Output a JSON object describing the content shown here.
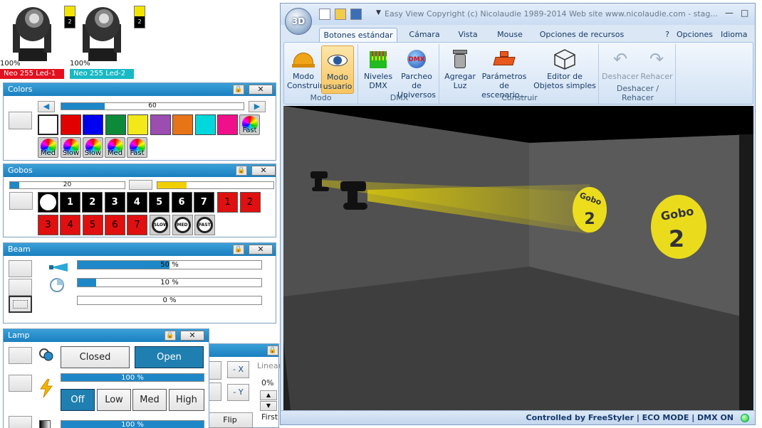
{
  "fixtures": [
    {
      "name": "Neo 255 Led-1",
      "percent": "100%",
      "badge": "2",
      "color": "#e3101f"
    },
    {
      "name": "Neo 255 Led-2",
      "percent": "100%",
      "badge": "2",
      "color": "#18b9c4"
    }
  ],
  "colors_panel": {
    "title": "Colors",
    "slider_value": "60",
    "slider_fraction": 0.24,
    "swatches": [
      "#ffffff",
      "#e30000",
      "#0000f0",
      "#0c8a3a",
      "#f2e81a",
      "#9b4db0",
      "#e87418",
      "#00d8dc",
      "#f0108a"
    ],
    "speed_labels": [
      "Fast",
      "Med",
      "Slow",
      "Slow",
      "Med",
      "Fast"
    ]
  },
  "gobos_panel": {
    "title": "Gobos",
    "slider_value": "20",
    "slider_fraction": 0.08,
    "yellow_fraction": 0.25,
    "gobos_black": [
      "1",
      "2",
      "3",
      "4",
      "5",
      "6",
      "7"
    ],
    "gobos_red": [
      "1",
      "2",
      "3",
      "4",
      "5",
      "6",
      "7"
    ],
    "rotation_labels": [
      "SLOW",
      "MED",
      "FAST"
    ]
  },
  "beam_panel": {
    "title": "Beam",
    "sliders": [
      {
        "label": "50 %",
        "fraction": 0.5
      },
      {
        "label": "10 %",
        "fraction": 0.1
      },
      {
        "label": "0 %",
        "fraction": 0.0
      }
    ]
  },
  "lamp_panel": {
    "title": "Lamp",
    "closed_label": "Closed",
    "open_label": "Open",
    "slider1_label": "100 %",
    "power_buttons": [
      "Off",
      "Low",
      "Med",
      "High"
    ],
    "slider2_label": "100 %"
  },
  "hidden_panel": {
    "linear_label": "Linear",
    "zero_pct": "0%",
    "first_label": "First",
    "minus_x": "- X",
    "minus_y": "- Y",
    "flip": "Flip"
  },
  "window": {
    "title": "Easy View   Copyright (c) Nicolaudie 1989-2014   Web site www.nicolaudie.com - stag...",
    "app_button": "3D",
    "tabs": [
      "Botones estándar",
      "Cámara",
      "Vista",
      "Mouse",
      "Opciones de recursos"
    ],
    "right_menu": [
      "?",
      "Opciones",
      "Idioma"
    ],
    "ribbon_groups": [
      {
        "name": "Modo",
        "buttons": [
          "Modo Construir",
          "Modo usuario"
        ]
      },
      {
        "name": "DMX",
        "buttons": [
          "Niveles DMX",
          "Parcheo de Universos"
        ]
      },
      {
        "name": "Construir",
        "buttons": [
          "Agregar Luz",
          "Parámetros de escenario...",
          "Editor de Objetos simples"
        ]
      },
      {
        "name": "Deshacer / Rehacer",
        "buttons": [
          "Deshacer",
          "Rehacer"
        ]
      }
    ],
    "scene": {
      "gobo_text": "Gobo",
      "gobo_number": "2"
    },
    "status": "Controlled by FreeStyler  |  ECO MODE  |  DMX ON"
  }
}
